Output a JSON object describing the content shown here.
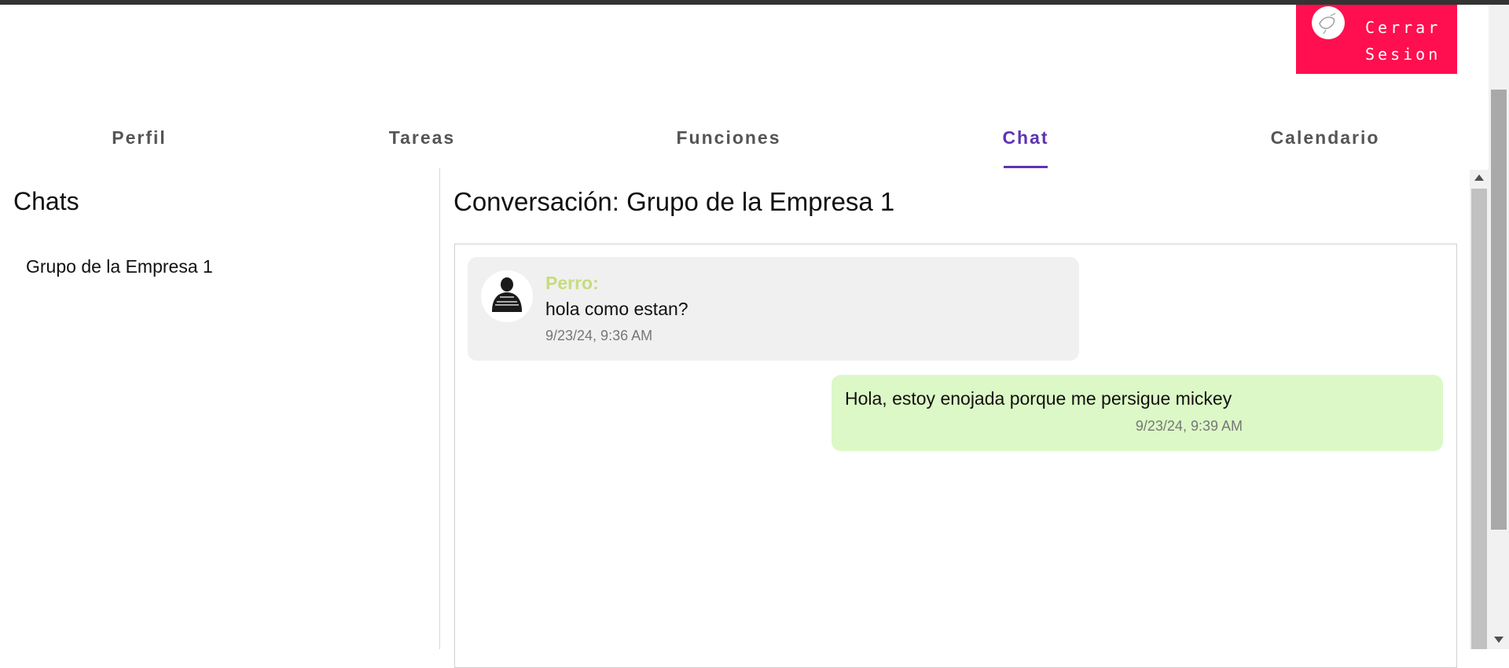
{
  "header": {
    "logout_label": "Cerrar Sesion",
    "brand_color": "#ff0f4f"
  },
  "tabs": [
    {
      "label": "Perfil",
      "active": false
    },
    {
      "label": "Tareas",
      "active": false
    },
    {
      "label": "Funciones",
      "active": false
    },
    {
      "label": "Chat",
      "active": true
    },
    {
      "label": "Calendario",
      "active": false
    }
  ],
  "sidebar": {
    "title": "Chats",
    "items": [
      {
        "label": "Grupo de la Empresa 1"
      }
    ]
  },
  "conversation": {
    "title": "Conversación: Grupo de la Empresa 1",
    "messages": [
      {
        "sender": "Perro:",
        "text": "hola como estan?",
        "time": "9/23/24, 9:36 AM",
        "incoming": true
      },
      {
        "text": "Hola, estoy enojada porque me persigue mickey",
        "time": "9/23/24, 9:39 AM",
        "incoming": false
      }
    ]
  },
  "colors": {
    "active_tab": "#5e35b1",
    "incoming_bubble": "#f0f0f0",
    "outgoing_bubble": "#dcf8c6",
    "sender_name": "#c7dc7d"
  }
}
